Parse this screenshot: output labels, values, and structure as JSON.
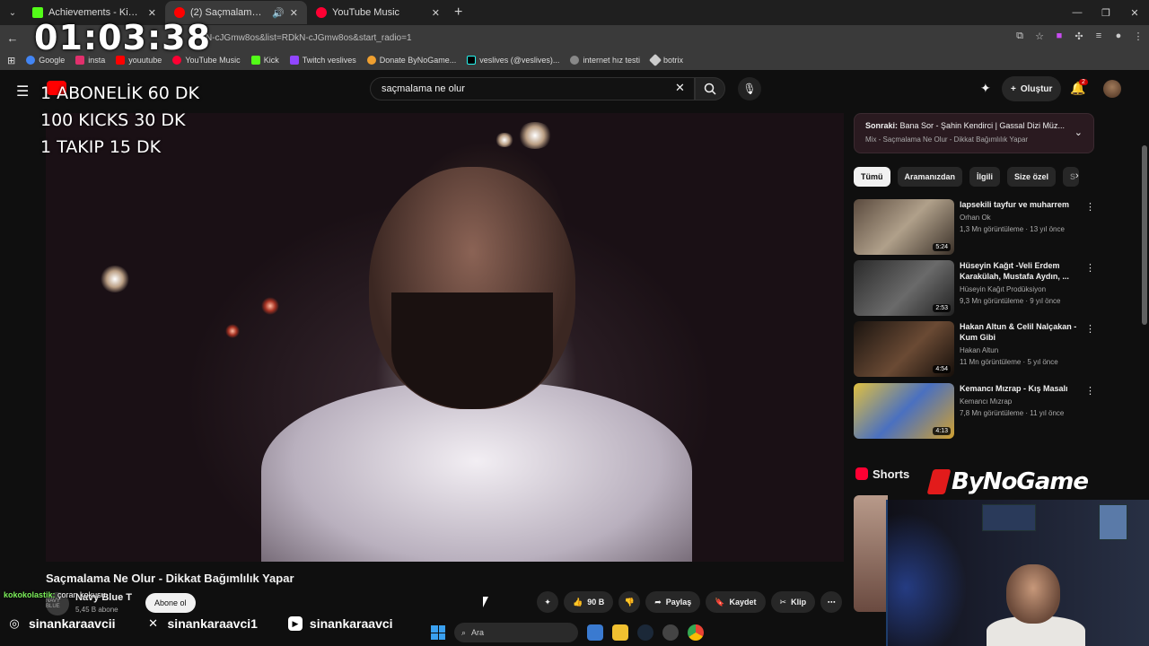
{
  "tabs": [
    {
      "label": "Achievements - Kick Dashboard",
      "favicon_color": "#53fc18",
      "close": "✕"
    },
    {
      "label": "(2) Saçmalama Ne Olur - Di",
      "favicon_color": "#ff0000",
      "close": "✕"
    },
    {
      "label": "YouTube Music",
      "favicon_color": "#ff0033",
      "close": "✕"
    }
  ],
  "url": "kN-cJGmw8os&list=RDkN-cJGmw8os&start_radio=1",
  "bookmarks": [
    {
      "label": "Google",
      "color": "#4285f4"
    },
    {
      "label": "insta",
      "color": "#e1306c"
    },
    {
      "label": "youutube",
      "color": "#ff0000"
    },
    {
      "label": "YouTube Music",
      "color": "#ff0033"
    },
    {
      "label": "Kick",
      "color": "#53fc18"
    },
    {
      "label": "Twitch veslives",
      "color": "#9146ff"
    },
    {
      "label": "Donate ByNoGame...",
      "color": "#f0a030"
    },
    {
      "label": "veslives (@veslives)...",
      "color": "#000000"
    },
    {
      "label": "internet hız testi",
      "color": "#888888"
    },
    {
      "label": "botrix",
      "color": "#cccccc"
    }
  ],
  "search": {
    "query": "saçmalama ne olur"
  },
  "header": {
    "create_label": "Oluştur",
    "notif_count": "2"
  },
  "video": {
    "title": "Saçmalama Ne Olur - Dikkat Bağımlılık Yapar",
    "channel": "Navy Blue T",
    "avatar_text": "NAVY BLUE",
    "subs": "5,45 B abone",
    "subscribe_label": "Abone ol",
    "likes": "90 B",
    "share": "Paylaş",
    "save": "Kaydet",
    "clip": "Klip"
  },
  "up_next": {
    "prefix": "Sonraki:",
    "title": "Bana Sor - Şahin Kendirci | Gassal Dizi Müz...",
    "mix": "Mix - Saçmalama Ne Olur - Dikkat Bağımlılık Yapar"
  },
  "chips": [
    "Tümü",
    "Aramanızdan",
    "İlgili",
    "Size özel",
    "S"
  ],
  "recommendations": [
    {
      "title": "lapsekili tayfur ve muharrem",
      "channel": "Orhan Ok",
      "meta": "1,3 Mn görüntüleme · 13 yıl önce",
      "duration": "5:24"
    },
    {
      "title": "Hüseyin Kağıt -Veli Erdem Karakülah, Mustafa Aydın, ...",
      "channel": "Hüseyin Kağıt Prodüksiyon",
      "meta": "9,3 Mn görüntüleme · 9 yıl önce",
      "duration": "2:53"
    },
    {
      "title": "Hakan Altun & Celil Nalçakan - Kum Gibi",
      "channel": "Hakan Altun",
      "meta": "11 Mn görüntüleme · 5 yıl önce",
      "duration": "4:54"
    },
    {
      "title": "Kemancı Mızrap - Kış Masalı",
      "channel": "Kemancı Mızrap",
      "meta": "7,8 Mn görüntüleme · 11 yıl önce",
      "duration": "4:13"
    }
  ],
  "shorts_label": "Shorts",
  "overlay": {
    "timer": "01:03:38",
    "goals": [
      "1 ABONELİK 60 DK",
      "100 KICKS 30 DK",
      "1 TAKIP 15 DK"
    ],
    "sponsor": "ByNoGame",
    "chat_user": "kokokolastik:",
    "chat_msg": "çoran kokusu"
  },
  "socials": [
    {
      "icon": "instagram-icon",
      "glyph": "◎",
      "handle": "sinankaraavcii"
    },
    {
      "icon": "x-icon",
      "glyph": "✕",
      "handle": "sinankaraavci1"
    },
    {
      "icon": "youtube-icon",
      "glyph": "▶",
      "handle": "sinankaraavci"
    }
  ],
  "taskbar": {
    "search_placeholder": "Ara"
  }
}
